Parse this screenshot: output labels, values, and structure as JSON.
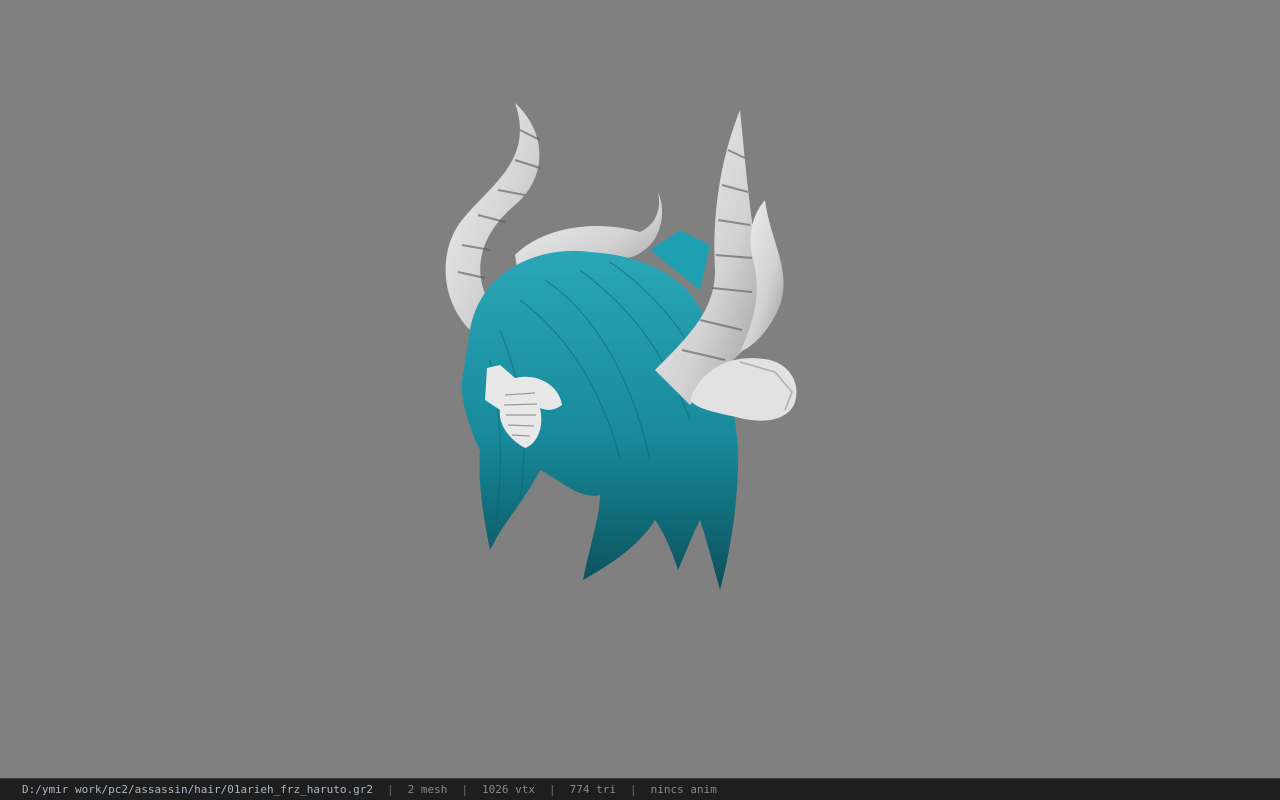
{
  "viewer": {
    "background_color": "#808080",
    "model": {
      "hair_color": "#1a8fa0",
      "horn_color": "#d8d8d8",
      "icon": "hair-model-with-horns"
    }
  },
  "statusbar": {
    "file_path": "D:/ymir work/pc2/assassin/hair/01arieh_frz_haruto.gr2",
    "separator": "|",
    "mesh_count": "2 mesh",
    "vertex_count": "1026 vtx",
    "triangle_count": "774 tri",
    "anim_status": "nincs anim"
  }
}
